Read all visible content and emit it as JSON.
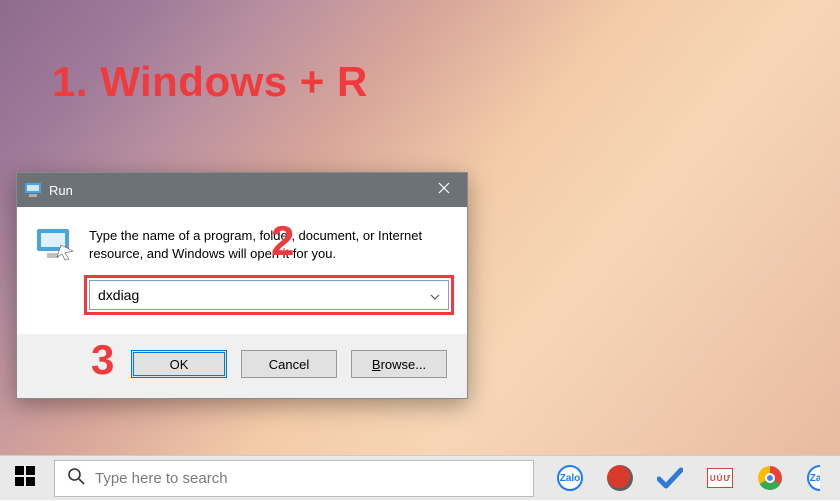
{
  "annotations": {
    "step1": "1. Windows + R",
    "step2": "2",
    "step3": "3"
  },
  "run_dialog": {
    "title": "Run",
    "instructions": "Type the name of a program, folder, document, or Internet resource, and Windows will open it for you.",
    "open_value": "dxdiag",
    "buttons": {
      "ok": "OK",
      "cancel": "Cancel",
      "browse_prefix": "B",
      "browse_rest": "rowse..."
    }
  },
  "taskbar": {
    "search_placeholder": "Type here to search",
    "tray": {
      "zalo": "Zalo"
    }
  }
}
